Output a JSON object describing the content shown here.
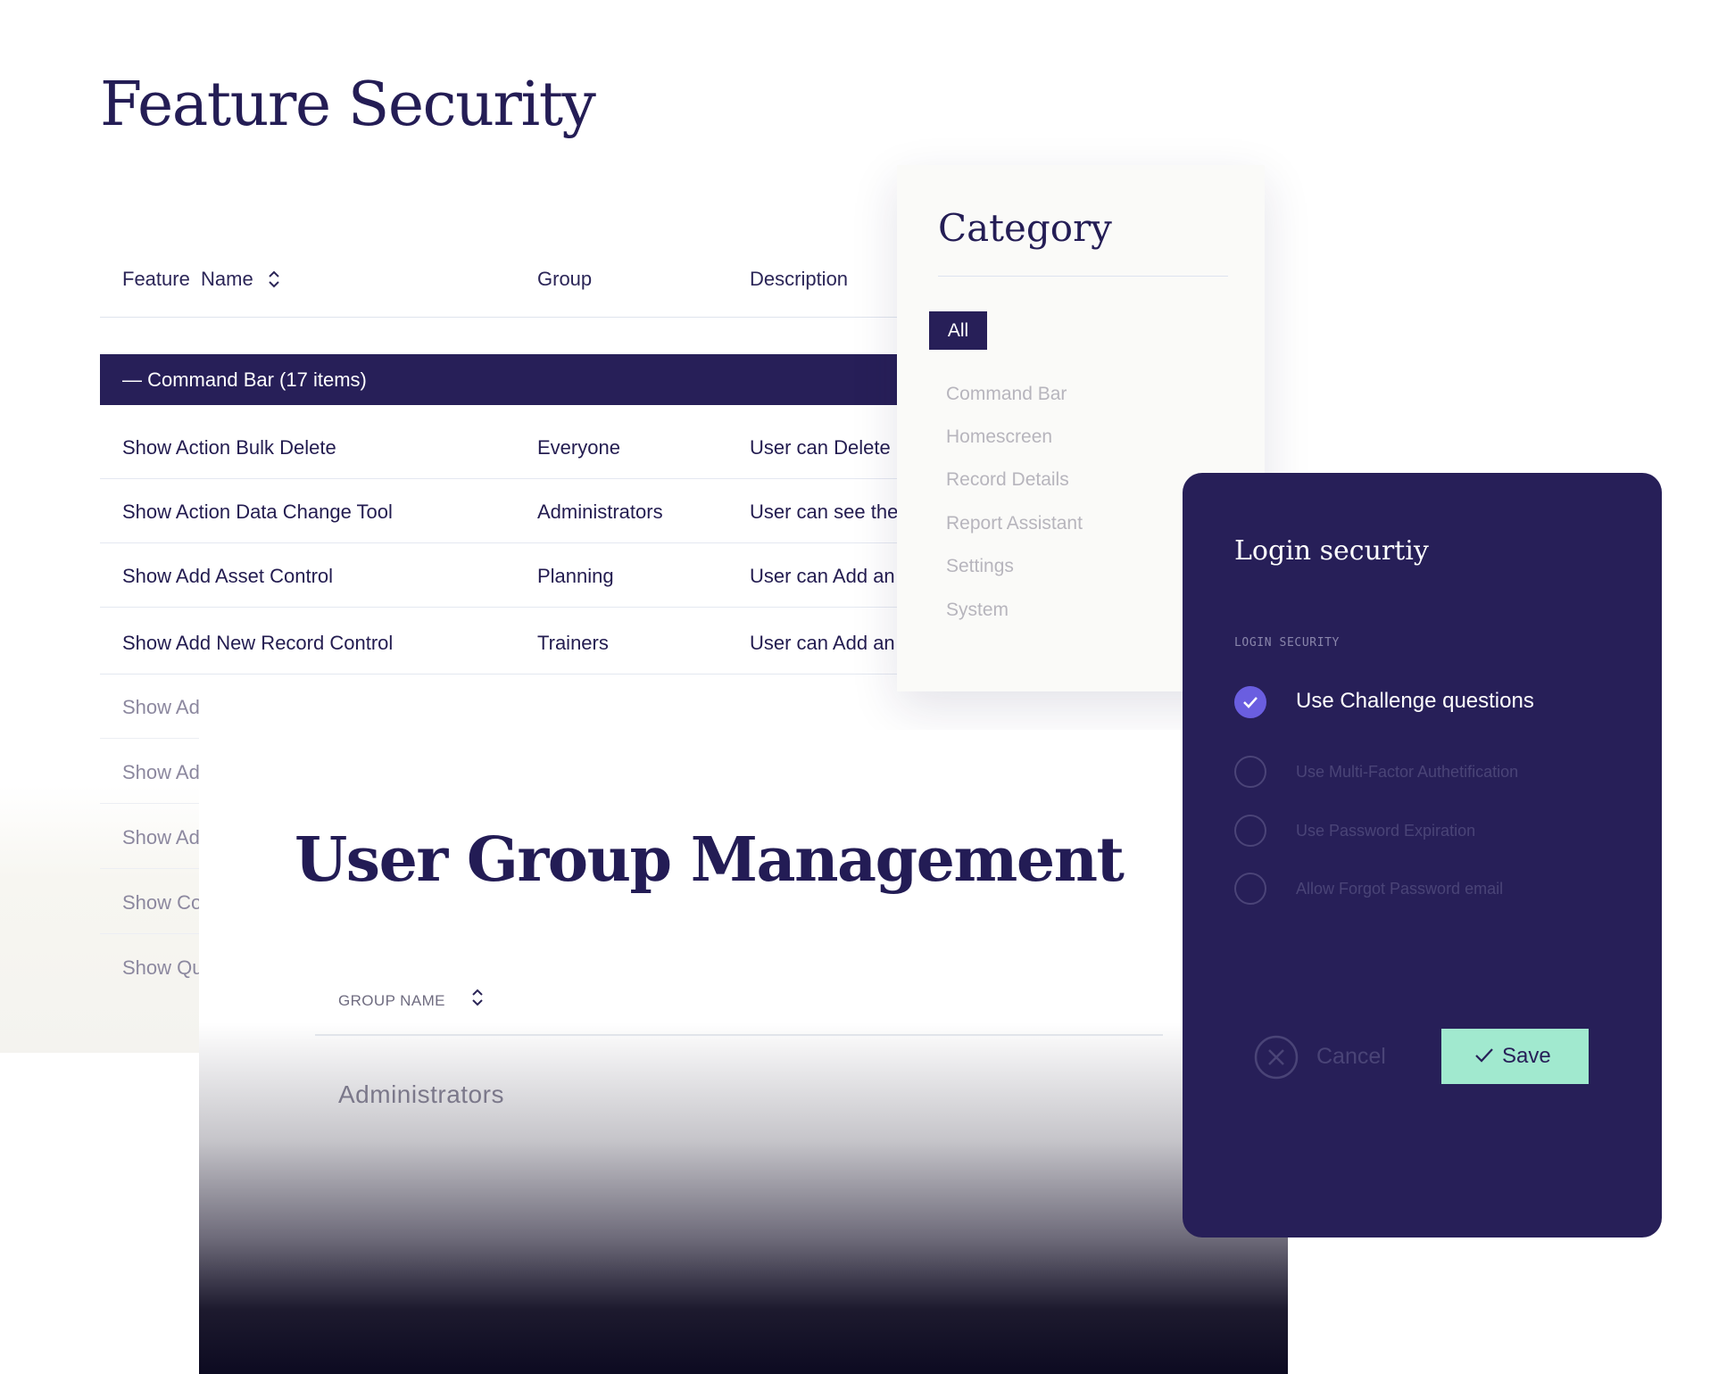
{
  "feature_security": {
    "title": "Feature Security",
    "columns": {
      "name": "Feature  Name",
      "group": "Group",
      "description": "Description"
    },
    "group_row": "—  Command Bar (17 items)",
    "rows": [
      {
        "name": "Show Action Bulk Delete",
        "group": "Everyone",
        "description": "User can Delete"
      },
      {
        "name": "Show Action Data Change Tool",
        "group": "Administrators",
        "description": "User can see the"
      },
      {
        "name": "Show Add Asset Control",
        "group": "Planning",
        "description": "User can Add an"
      },
      {
        "name": "Show Add New Record Control",
        "group": "Trainers",
        "description": "User can Add an"
      },
      {
        "name": "Show Ad"
      },
      {
        "name": "Show Ad"
      },
      {
        "name": "Show Ad"
      },
      {
        "name": "Show Co"
      },
      {
        "name": "Show Qu"
      }
    ]
  },
  "category": {
    "title": "Category",
    "selected": "All",
    "items": [
      "Command Bar",
      "Homescreen",
      "Record Details",
      "Report Assistant",
      "Settings",
      "System"
    ]
  },
  "user_group_management": {
    "title": "User Group Management",
    "column": "GROUP NAME",
    "rows": [
      "Administrators"
    ]
  },
  "login_security": {
    "title": "Login securtiy",
    "section_label": "LOGIN SECURITY",
    "options": [
      {
        "label": "Use Challenge questions",
        "checked": true
      },
      {
        "label": "Use Multi-Factor Authetification",
        "checked": false
      },
      {
        "label": "Use Password Expiration",
        "checked": false
      },
      {
        "label": "Allow Forgot Password email",
        "checked": false
      }
    ],
    "cancel_label": "Cancel",
    "save_label": "Save"
  },
  "colors": {
    "navy": "#271f58",
    "accent_purple": "#6a5ee0",
    "save_green": "#a1e9cf"
  }
}
